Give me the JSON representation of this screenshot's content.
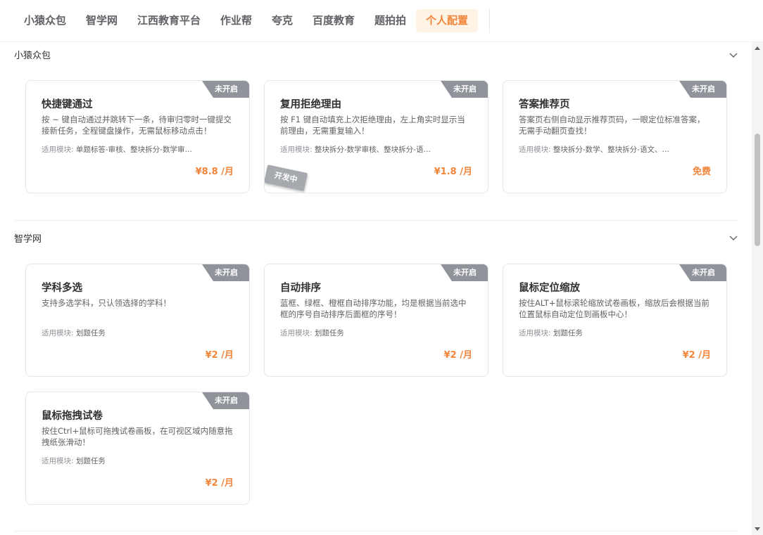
{
  "tabs": [
    {
      "label": "小猿众包"
    },
    {
      "label": "智学网"
    },
    {
      "label": "江西教育平台"
    },
    {
      "label": "作业帮"
    },
    {
      "label": "夸克"
    },
    {
      "label": "百度教育"
    },
    {
      "label": "题拍拍"
    },
    {
      "label": "个人配置",
      "active": true
    }
  ],
  "accent_color": "#f2853a",
  "sections": [
    {
      "title": "小猿众包",
      "cards": [
        {
          "title": "快捷键通过",
          "desc": "按 ~ 键自动通过并跳转下一条，待审归零时一键提交接新任务，全程键盘操作，无需鼠标移动点击！",
          "module_label": "适用模块:",
          "module": "单题标答-审核、整块拆分-数学审…",
          "price": "¥8.8 /月",
          "status": "未开启"
        },
        {
          "title": "复用拒绝理由",
          "desc": "按 F1 键自动填充上次拒绝理由，左上角实时显示当前理由，无需重复输入！",
          "module_label": "适用模块:",
          "module": "整块拆分-数学审核、整块拆分-语…",
          "price": "¥1.8 /月",
          "status": "未开启",
          "dev_tag": "开发中"
        },
        {
          "title": "答案推荐页",
          "desc": "答案页右侧自动显示推荐页码，一眼定位标准答案，无需手动翻页查找！",
          "module_label": "适用模块:",
          "module": "整块拆分-数学、整块拆分-语文、…",
          "price": "免费",
          "status": "未开启"
        }
      ]
    },
    {
      "title": "智学网",
      "cards": [
        {
          "title": "学科多选",
          "desc": "支持多选学科，只认领选择的学科！",
          "module_label": "适用模块:",
          "module": "划题任务",
          "price": "¥2 /月",
          "status": "未开启"
        },
        {
          "title": "自动排序",
          "desc": "蓝框、绿框、橙框自动排序功能，均是根据当前选中框的序号自动排序后面框的序号！",
          "module_label": "适用模块:",
          "module": "划题任务",
          "price": "¥2 /月",
          "status": "未开启"
        },
        {
          "title": "鼠标定位缩放",
          "desc": "按住ALT+鼠标滚轮缩放试卷画板，缩放后会根据当前位置鼠标自动定位到画板中心！",
          "module_label": "适用模块:",
          "module": "划题任务",
          "price": "¥2 /月",
          "status": "未开启"
        },
        {
          "title": "鼠标拖拽试卷",
          "desc": "按住Ctrl+鼠标可拖拽试卷画板，在可视区域内随意拖拽纸张滑动！",
          "module_label": "适用模块:",
          "module": "划题任务",
          "price": "¥2 /月",
          "status": "未开启"
        }
      ]
    }
  ]
}
